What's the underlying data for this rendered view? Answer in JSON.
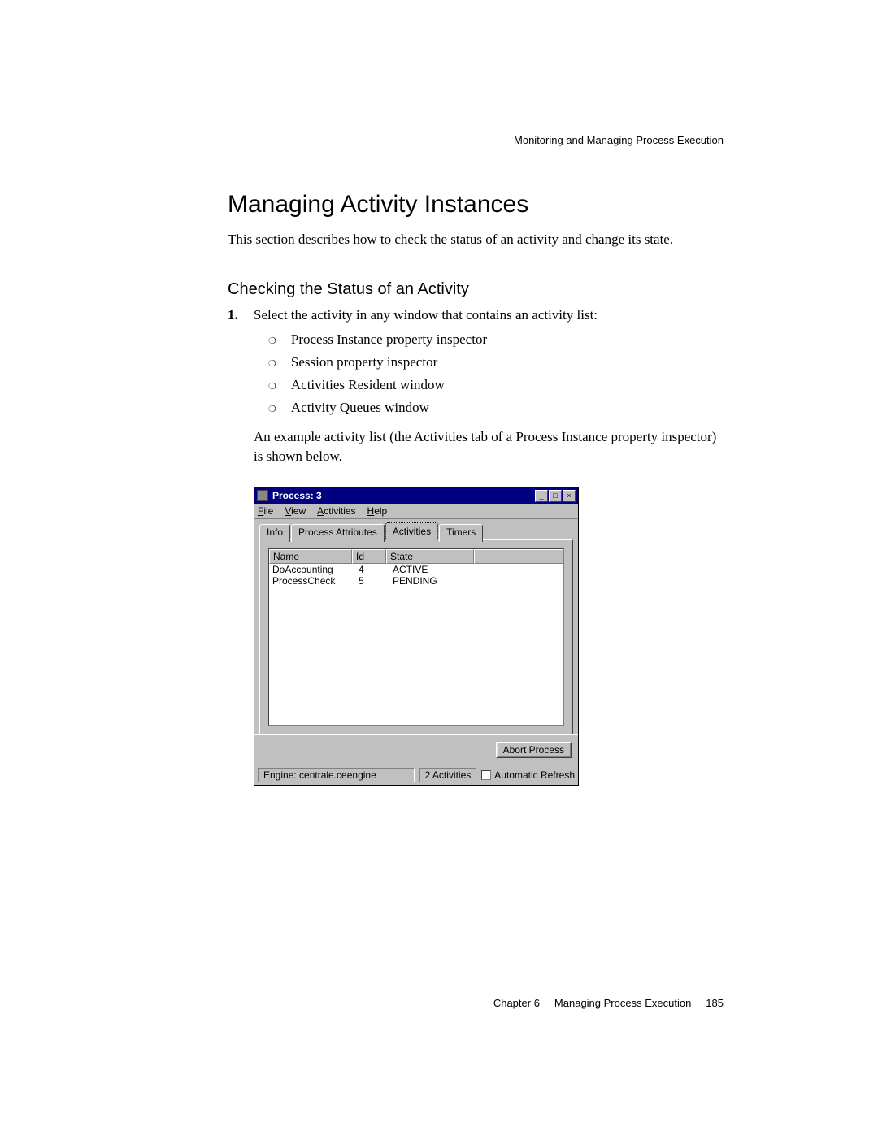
{
  "running_head": "Monitoring and Managing Process Execution",
  "h1": "Managing Activity Instances",
  "intro": "This section describes how to check the status of an activity and change its state.",
  "h2": "Checking the Status of an Activity",
  "step_num": "1.",
  "step_text": "Select the activity in any window that contains an activity list:",
  "sub_items": [
    "Process Instance property inspector",
    "Session property inspector",
    "Activities Resident window",
    "Activity Queues window"
  ],
  "after_list": "An example activity list (the Activities tab of a Process Instance property inspector) is shown below.",
  "window": {
    "title": "Process: 3",
    "menus": {
      "file": {
        "u": "F",
        "rest": "ile"
      },
      "view": {
        "u": "V",
        "rest": "iew"
      },
      "activities": {
        "u": "A",
        "rest": "ctivities"
      },
      "help": {
        "u": "H",
        "rest": "elp"
      }
    },
    "tabs": {
      "info": "Info",
      "process_attributes": "Process Attributes",
      "activities": "Activities",
      "timers": "Timers"
    },
    "columns": {
      "name": "Name",
      "id": "Id",
      "state": "State"
    },
    "rows": [
      {
        "name": "DoAccounting",
        "id": "4",
        "state": "ACTIVE"
      },
      {
        "name": "ProcessCheck",
        "id": "5",
        "state": "PENDING"
      }
    ],
    "abort_btn": "Abort Process",
    "status_engine": "Engine: centrale.ceengine",
    "status_count": "2 Activities",
    "auto_refresh": "Automatic Refresh"
  },
  "footer": {
    "chapter": "Chapter    6",
    "title": "Managing Process Execution",
    "page": "185"
  }
}
